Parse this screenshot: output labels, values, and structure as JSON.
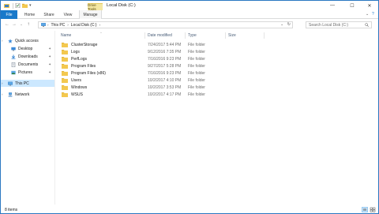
{
  "window": {
    "title": "Local Disk (C:)",
    "context_tab": "Drive Tools"
  },
  "quick_access": {
    "dropdown_glyph": "▾"
  },
  "controls": {
    "minimize": "—",
    "maximize": "☐",
    "close": "✕"
  },
  "ribbon": {
    "tabs": [
      {
        "label": "File"
      },
      {
        "label": "Home"
      },
      {
        "label": "Share"
      },
      {
        "label": "View"
      },
      {
        "label": "Manage"
      }
    ],
    "expand_glyph": "⌄",
    "help_glyph": "?"
  },
  "address": {
    "back": "←",
    "forward": "→",
    "recent": "⌄",
    "up": "↑",
    "crumbs": [
      "This PC",
      "Local Disk (C:)"
    ],
    "separator": "›",
    "dropdown": "⌄",
    "refresh": "↻"
  },
  "search": {
    "placeholder": "Search Local Disk (C:)",
    "icon": "search-icon"
  },
  "nav": {
    "quick_access": "Quick access",
    "items": [
      {
        "label": "Desktop",
        "icon": "desktop-icon",
        "pinned": true
      },
      {
        "label": "Downloads",
        "icon": "downloads-icon",
        "pinned": true
      },
      {
        "label": "Documents",
        "icon": "documents-icon",
        "pinned": true
      },
      {
        "label": "Pictures",
        "icon": "pictures-icon",
        "pinned": true
      }
    ],
    "this_pc": "This PC",
    "network": "Network",
    "pin_glyph": "✦",
    "chevron": "›"
  },
  "columns": {
    "name": "Name",
    "date": "Date modified",
    "type": "Type",
    "size": "Size",
    "sort_glyph": "^"
  },
  "files": [
    {
      "name": "ClusterStorage",
      "date": "7/24/2017 5:44 PM",
      "type": "File folder"
    },
    {
      "name": "Logs",
      "date": "9/12/2016 7:35 PM",
      "type": "File folder"
    },
    {
      "name": "PerfLogs",
      "date": "7/16/2016 9:23 PM",
      "type": "File folder"
    },
    {
      "name": "Program Files",
      "date": "9/27/2017 5:28 PM",
      "type": "File folder"
    },
    {
      "name": "Program Files (x86)",
      "date": "7/16/2016 9:23 PM",
      "type": "File folder"
    },
    {
      "name": "Users",
      "date": "10/2/2017 4:10 PM",
      "type": "File folder"
    },
    {
      "name": "Windows",
      "date": "10/2/2017 3:53 PM",
      "type": "File folder"
    },
    {
      "name": "WSUS",
      "date": "10/2/2017 4:17 PM",
      "type": "File folder"
    }
  ],
  "status": {
    "item_count": "8 items"
  },
  "colors": {
    "accent": "#1979ca",
    "folder": "#f3c84f",
    "selected": "#cce8ff",
    "drive_tools": "#f4e7a2"
  }
}
